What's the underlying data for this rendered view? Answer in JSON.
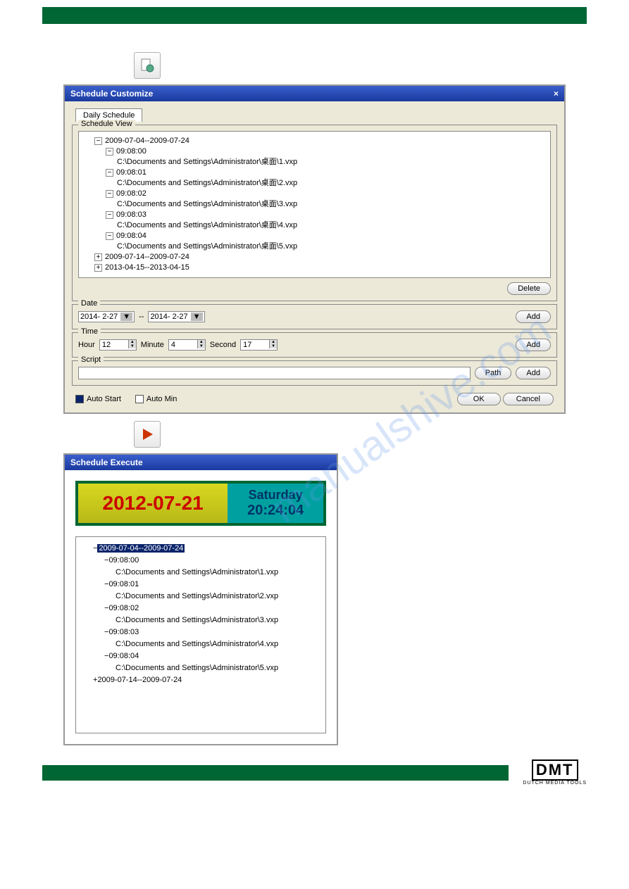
{
  "customize": {
    "title": "Schedule Customize",
    "tab": "Daily Schedule",
    "schedule_view_label": "Schedule View",
    "tree": {
      "r1": "2009-07-04--2009-07-24",
      "t1": "09:08:00",
      "f1": "C:\\Documents and Settings\\Administrator\\桌面\\1.vxp",
      "t2": "09:08:01",
      "f2": "C:\\Documents and Settings\\Administrator\\桌面\\2.vxp",
      "t3": "09:08:02",
      "f3": "C:\\Documents and Settings\\Administrator\\桌面\\3.vxp",
      "t4": "09:08:03",
      "f4": "C:\\Documents and Settings\\Administrator\\桌面\\4.vxp",
      "t5": "09:08:04",
      "f5": "C:\\Documents and Settings\\Administrator\\桌面\\5.vxp",
      "r2": "2009-07-14--2009-07-24",
      "r3": "2013-04-15--2013-04-15"
    },
    "delete_btn": "Delete",
    "date": {
      "label": "Date",
      "from": "2014- 2-27",
      "sep": "--",
      "to": "2014- 2-27",
      "add": "Add"
    },
    "time": {
      "label": "Time",
      "hour_lbl": "Hour",
      "hour": "12",
      "min_lbl": "Minute",
      "min": "4",
      "sec_lbl": "Second",
      "sec": "17",
      "add": "Add"
    },
    "script": {
      "label": "Script",
      "path_btn": "Path",
      "add": "Add"
    },
    "auto_start": "Auto Start",
    "auto_min": "Auto Min",
    "ok": "OK",
    "cancel": "Cancel"
  },
  "execute": {
    "title": "Schedule Execute",
    "date": "2012-07-21",
    "day": "Saturday",
    "time": "20:24:04",
    "tree": {
      "r1": "2009-07-04--2009-07-24",
      "t1": "09:08:00",
      "f1": "C:\\Documents and Settings\\Administrator\\1.vxp",
      "t2": "09:08:01",
      "f2": "C:\\Documents and Settings\\Administrator\\2.vxp",
      "t3": "09:08:02",
      "f3": "C:\\Documents and Settings\\Administrator\\3.vxp",
      "t4": "09:08:03",
      "f4": "C:\\Documents and Settings\\Administrator\\4.vxp",
      "t5": "09:08:04",
      "f5": "C:\\Documents and Settings\\Administrator\\5.vxp",
      "r2": "2009-07-14--2009-07-24"
    }
  },
  "footer": {
    "brand": "DMT",
    "tagline": "DUTCH MEDIA TOOLS"
  },
  "watermark": "manualshive.com"
}
